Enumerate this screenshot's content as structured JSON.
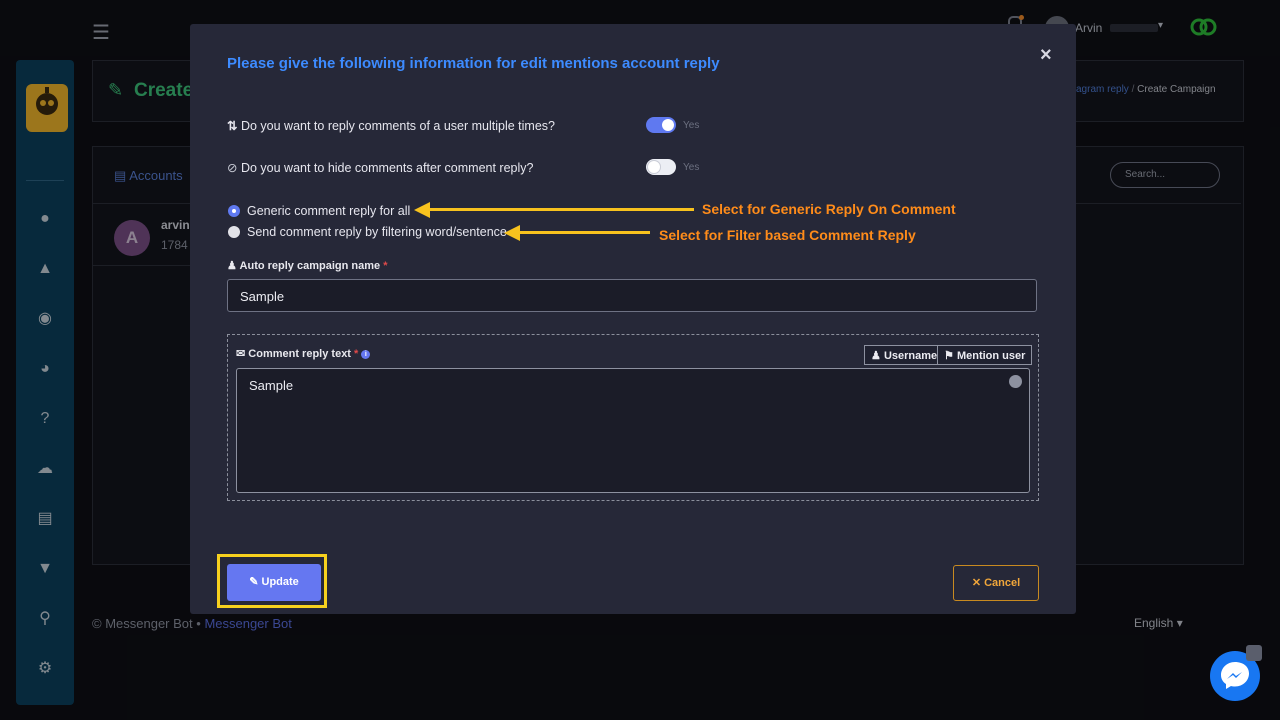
{
  "topbar": {
    "menu_icon": "menu-icon",
    "user_name": "Arvin",
    "user_suffix": "▾"
  },
  "background": {
    "page_title": "Create",
    "breadcrumb_prev": "agram reply",
    "breadcrumb_sep": "/",
    "breadcrumb_current": "Create Campaign",
    "accounts_tab": "Accounts",
    "account_name": "arvin.",
    "account_id": "1784",
    "account_avatar": "A",
    "search_placeholder": "Search...",
    "footer_brand": "© Messenger Bot",
    "footer_dot": "•",
    "footer_link": "Messenger Bot",
    "language": "English ▾"
  },
  "modal": {
    "title": "Please give the following information for edit mentions account reply",
    "close": "×",
    "q1": "Do you want to reply comments of a user multiple times?",
    "q1_toggle_label": "Yes",
    "q1_on": true,
    "q2": "Do you want to hide comments after comment reply?",
    "q2_toggle_label": "Yes",
    "q2_on": false,
    "radio_generic": "Generic comment reply for all",
    "radio_filter": "Send comment reply by filtering word/sentence",
    "annot_generic": "Select for Generic Reply On Comment",
    "annot_filter": "Select for Filter based Comment Reply",
    "campaign_label": "Auto reply campaign name",
    "campaign_req": "*",
    "campaign_value": "Sample",
    "comment_label": "Comment reply text",
    "comment_req": "*",
    "chip_username": "Username",
    "chip_mention": "Mention user",
    "comment_value": "Sample",
    "update": "Update",
    "cancel": "Cancel"
  },
  "colors": {
    "accent": "#3d8bff",
    "annotation": "#ff8c1a",
    "arrow": "#f7c21e",
    "button": "#6577f1"
  }
}
